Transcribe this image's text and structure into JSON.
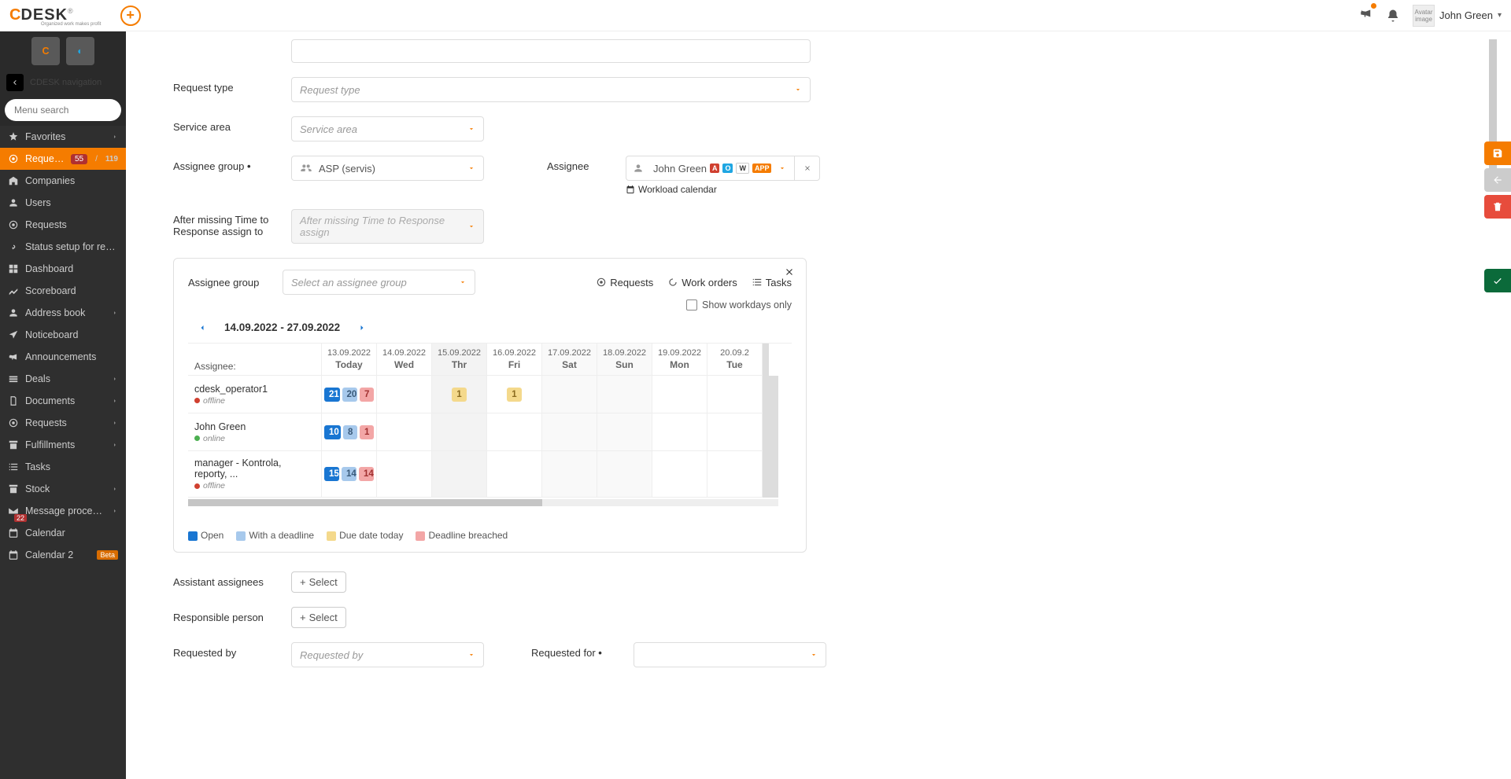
{
  "header": {
    "logo_c": "C",
    "logo_desk": "DESK",
    "logo_sub": "Organized work makes profit",
    "user_name": "John Green",
    "avatar_alt": "Avatar image"
  },
  "sidebar": {
    "nav_label": "CDESK navigation",
    "search_placeholder": "Menu search",
    "items": [
      {
        "label": "Favorites",
        "chevron": true
      },
      {
        "label": "Requests",
        "active": true,
        "badge_a": "55",
        "badge_b": "119"
      },
      {
        "label": "Companies"
      },
      {
        "label": "Users"
      },
      {
        "label": "Requests"
      },
      {
        "label": "Status setup for request"
      },
      {
        "label": "Dashboard"
      },
      {
        "label": "Scoreboard"
      },
      {
        "label": "Address book",
        "chevron": true
      },
      {
        "label": "Noticeboard"
      },
      {
        "label": "Announcements"
      },
      {
        "label": "Deals",
        "chevron": true
      },
      {
        "label": "Documents",
        "chevron": true
      },
      {
        "label": "Requests",
        "chevron": true
      },
      {
        "label": "Fulfillments",
        "chevron": true
      },
      {
        "label": "Tasks"
      },
      {
        "label": "Stock",
        "chevron": true
      },
      {
        "label": "Message processing",
        "chevron": true,
        "msg_badge": "22"
      },
      {
        "label": "Calendar"
      },
      {
        "label": "Calendar 2",
        "beta": "Beta"
      }
    ]
  },
  "form": {
    "request_type_label": "Request type",
    "request_type_placeholder": "Request type",
    "service_area_label": "Service area",
    "service_area_placeholder": "Service area",
    "assignee_group_label": "Assignee group",
    "assignee_group_value": "ASP (servis)",
    "assignee_label": "Assignee",
    "assignee_value": "John Green",
    "tags": [
      "A",
      "O",
      "W",
      "APP"
    ],
    "workload_link": "Workload calendar",
    "after_missing_label": "After missing Time to Response assign to",
    "after_missing_placeholder": "After missing Time to Response assign",
    "assistant_label": "Assistant assignees",
    "responsible_label": "Responsible person",
    "requested_by_label": "Requested by",
    "requested_by_placeholder": "Requested by",
    "requested_for_label": "Requested for",
    "select_btn": "Select"
  },
  "calendar": {
    "assignee_group_label": "Assignee group",
    "assignee_group_placeholder": "Select an assignee group",
    "links": {
      "requests": "Requests",
      "workorders": "Work orders",
      "tasks": "Tasks"
    },
    "show_workdays": "Show workdays only",
    "date_range": "14.09.2022 - 27.09.2022",
    "assignee_header": "Assignee:",
    "columns": [
      {
        "date": "13.09.2022",
        "day": "Today"
      },
      {
        "date": "14.09.2022",
        "day": "Wed"
      },
      {
        "date": "15.09.2022",
        "day": "Thr"
      },
      {
        "date": "16.09.2022",
        "day": "Fri"
      },
      {
        "date": "17.09.2022",
        "day": "Sat"
      },
      {
        "date": "18.09.2022",
        "day": "Sun"
      },
      {
        "date": "19.09.2022",
        "day": "Mon"
      },
      {
        "date": "20.09.2",
        "day": "Tue"
      }
    ],
    "rows": [
      {
        "name": "cdesk_operator1",
        "status": "offline",
        "online": false,
        "cells": [
          [
            {
              "v": "21",
              "c": "open"
            },
            {
              "v": "20",
              "c": "deadline"
            },
            {
              "v": "7",
              "c": "breach"
            }
          ],
          [],
          [
            {
              "v": "1",
              "c": "due"
            }
          ],
          [
            {
              "v": "1",
              "c": "due"
            }
          ],
          [],
          [],
          [],
          []
        ]
      },
      {
        "name": "John Green",
        "status": "online",
        "online": true,
        "cells": [
          [
            {
              "v": "10",
              "c": "open"
            },
            {
              "v": "8",
              "c": "deadline"
            },
            {
              "v": "1",
              "c": "breach"
            }
          ],
          [],
          [],
          [],
          [],
          [],
          [],
          []
        ]
      },
      {
        "name": "manager - Kontrola, reporty, ...",
        "status": "offline",
        "online": false,
        "cells": [
          [
            {
              "v": "15",
              "c": "open"
            },
            {
              "v": "14",
              "c": "deadline"
            },
            {
              "v": "14",
              "c": "breach"
            }
          ],
          [],
          [],
          [],
          [],
          [],
          [],
          []
        ]
      }
    ],
    "legend": {
      "open": "Open",
      "deadline": "With a deadline",
      "due": "Due date today",
      "breach": "Deadline breached"
    }
  }
}
